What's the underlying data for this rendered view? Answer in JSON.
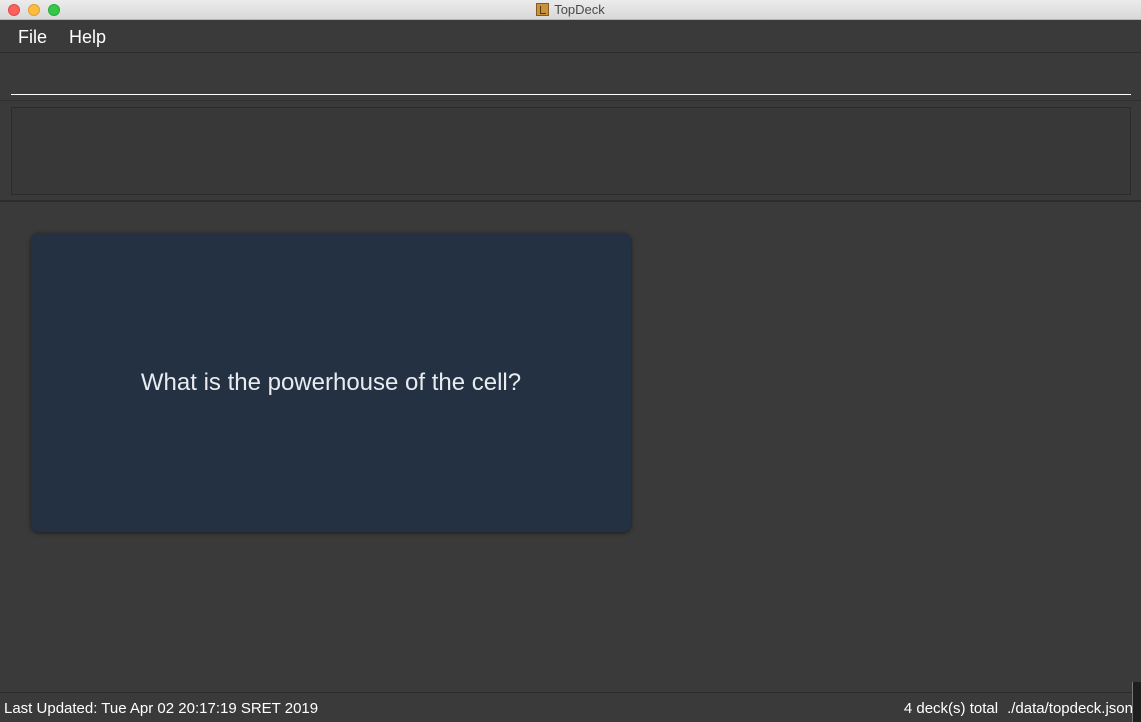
{
  "window": {
    "title": "TopDeck"
  },
  "menu": {
    "file_label": "File",
    "help_label": "Help"
  },
  "command_box": {
    "value": "",
    "placeholder": ""
  },
  "result_display": {
    "text": ""
  },
  "card": {
    "question": "What is the powerhouse of the cell?"
  },
  "status_bar": {
    "last_updated": "Last Updated: Tue Apr 02 20:17:19 SRET 2019",
    "deck_count": "4 deck(s) total",
    "save_path": "./data/topdeck.json"
  },
  "colors": {
    "background": "#3a3a3a",
    "card": "#243142",
    "text": "#ffffff"
  }
}
